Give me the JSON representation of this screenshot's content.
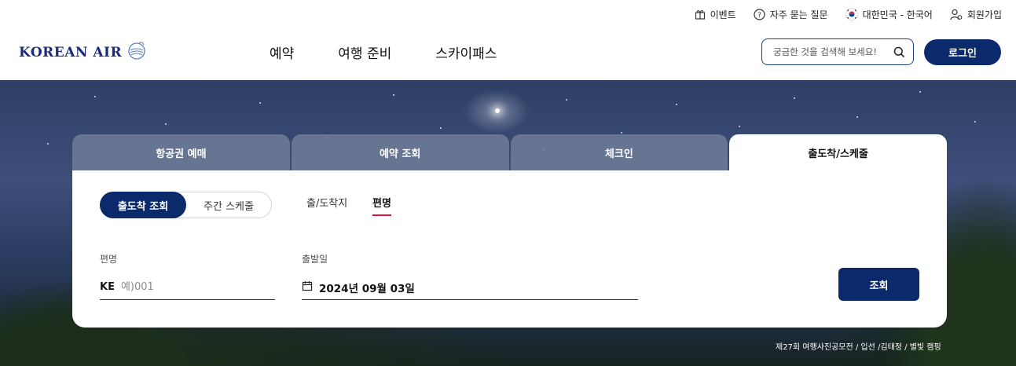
{
  "header": {
    "utility": {
      "event": "이벤트",
      "faq": "자주 묻는 질문",
      "language": "대한민국 - 한국어",
      "signup": "회원가입"
    },
    "logo_text": "KOREAN AIR",
    "nav": [
      "예약",
      "여행 준비",
      "스카이패스"
    ],
    "search": {
      "placeholder": "궁금한 것을 검색해 보세요!",
      "icon": "search-icon"
    },
    "login_label": "로그인"
  },
  "widget": {
    "tabs": [
      "항공권 예매",
      "예약 조회",
      "체크인",
      "출도착/스케줄"
    ],
    "active_tab": "출도착/스케줄",
    "mode_toggle": {
      "selected": "출도착 조회",
      "other": "주간 스케줄"
    },
    "search_by": {
      "route": "출/도착지",
      "flight_no": "편명",
      "selected": "편명"
    },
    "flight": {
      "label": "편명",
      "prefix": "KE",
      "placeholder": "예)001"
    },
    "date": {
      "label": "출발일",
      "value": "2024년 09월 03일",
      "icon": "calendar-icon"
    },
    "submit_label": "조회"
  },
  "hero": {
    "credit": "제27회 여행사진공모전 / 입선 /김태정 / 별빛 캠핑"
  },
  "colors": {
    "primary_navy": "#0b2a6c",
    "accent_red": "#d6193d",
    "tab_inactive": "#6e7d96"
  }
}
